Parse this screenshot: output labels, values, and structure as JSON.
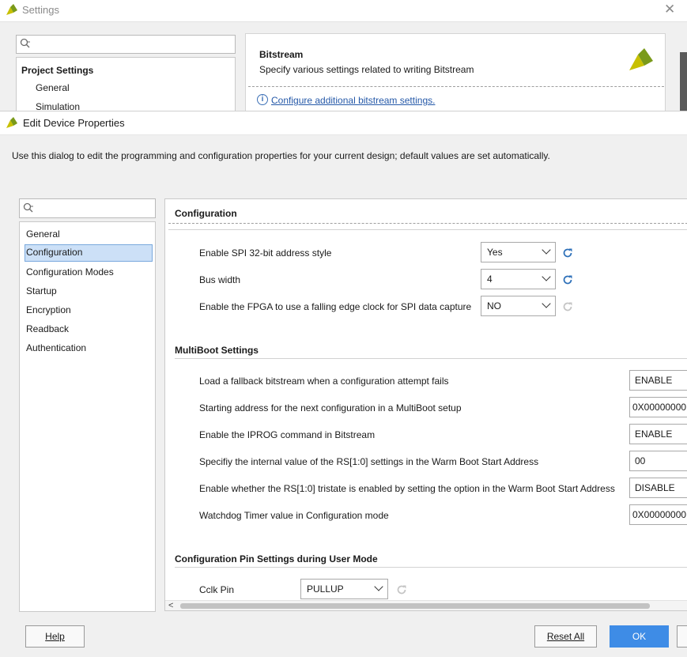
{
  "settings_window": {
    "title": "Settings",
    "search_icon": "search-icon",
    "tree": {
      "header": "Project Settings",
      "items": [
        "General",
        "Simulation"
      ]
    },
    "panel": {
      "title": "Bitstream",
      "subtitle": "Specify various settings related to writing Bitstream",
      "link": "Configure additional bitstream settings."
    }
  },
  "dialog": {
    "title": "Edit Device Properties",
    "intro": "Use this dialog to edit the programming and configuration properties for your current design; default values are set automatically.",
    "nav": {
      "items": [
        "General",
        "Configuration",
        "Configuration Modes",
        "Startup",
        "Encryption",
        "Readback",
        "Authentication"
      ],
      "selected": "Configuration"
    },
    "content": {
      "configuration": {
        "title": "Configuration",
        "props": [
          {
            "label": "Enable SPI 32-bit address style",
            "value": "Yes"
          },
          {
            "label": "Bus width",
            "value": "4"
          },
          {
            "label": "Enable the FPGA to use a falling edge clock for SPI data capture",
            "value": "NO"
          }
        ]
      },
      "multiboot": {
        "title": "MultiBoot Settings",
        "props": [
          {
            "label": "Load a fallback bitstream when a configuration attempt fails",
            "value": "ENABLE"
          },
          {
            "label": "Starting address for the next configuration in a MultiBoot setup",
            "value": "0X00000000"
          },
          {
            "label": "Enable the IPROG command in Bitstream",
            "value": "ENABLE"
          },
          {
            "label": "Specifiy the internal value of the RS[1:0] settings in the Warm Boot Start Address",
            "value": "00"
          },
          {
            "label": "Enable whether the RS[1:0] tristate is enabled by setting the option in the Warm Boot Start Address",
            "value": "DISABLE"
          },
          {
            "label": "Watchdog Timer value in Configuration mode",
            "value": "0X00000000"
          }
        ]
      },
      "user_mode": {
        "title": "Configuration Pin Settings during User Mode",
        "props": [
          {
            "label": "Cclk Pin",
            "value": "PULLUP"
          }
        ]
      }
    },
    "buttons": {
      "help": "Help",
      "reset_all": "Reset All",
      "ok": "OK"
    }
  },
  "colors": {
    "accent": "#3e8ce6",
    "selection": "#cce0f7",
    "link": "#2458a8",
    "logo_yellow": "#c8c000",
    "logo_green": "#7a9a1a"
  }
}
